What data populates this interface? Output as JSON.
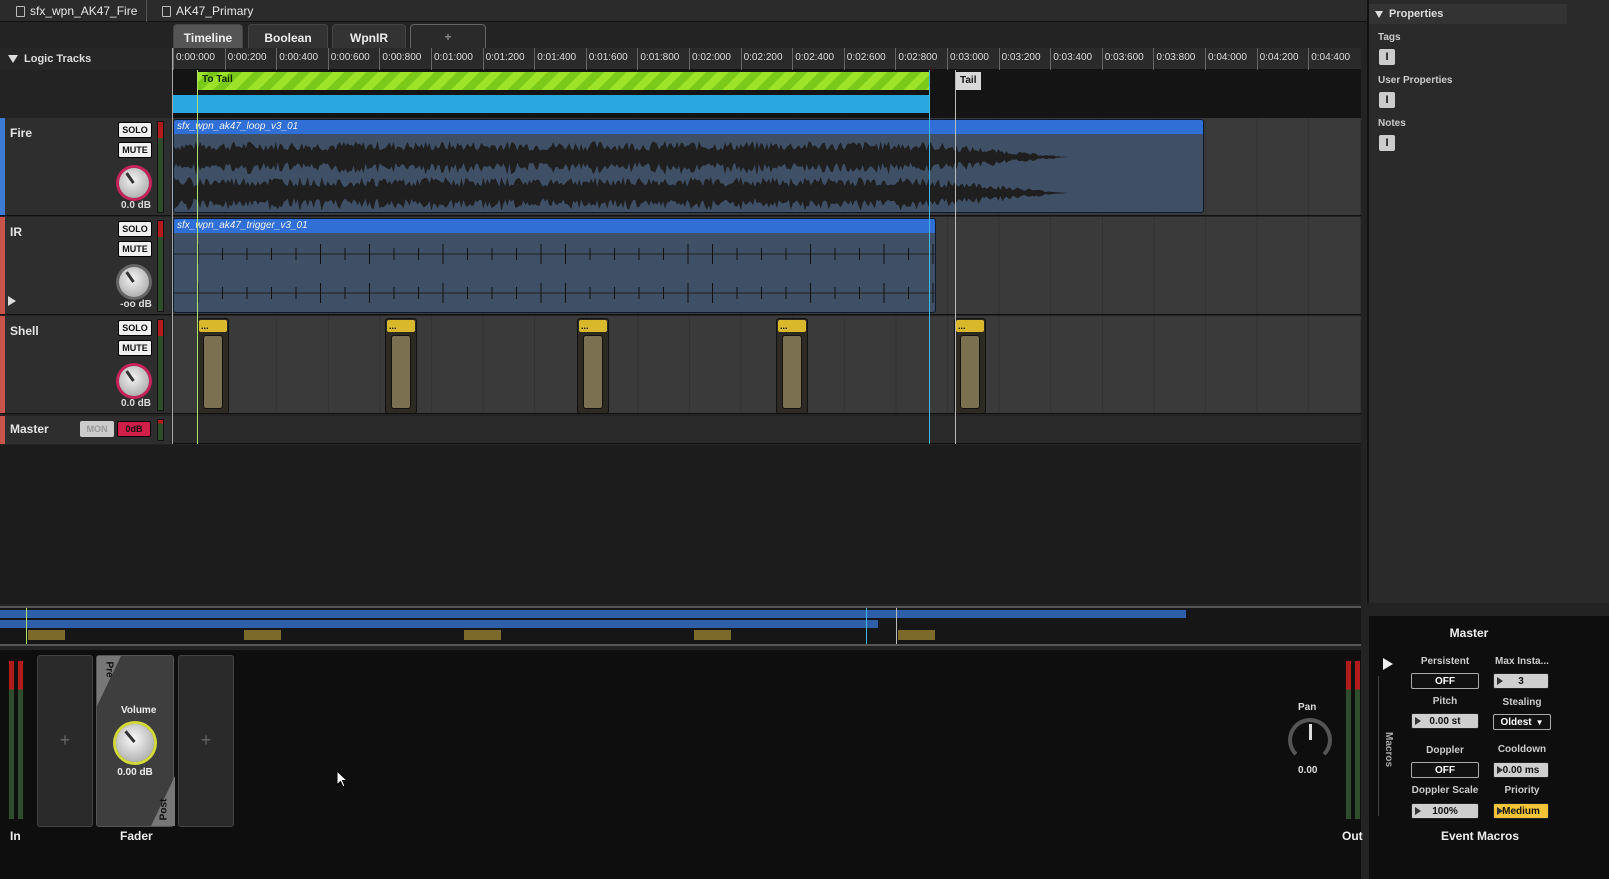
{
  "breadcrumb": [
    {
      "label": "sfx_wpn_AK47_Fire"
    },
    {
      "label": "AK47_Primary"
    }
  ],
  "tabs": [
    {
      "label": "Timeline",
      "active": true
    },
    {
      "label": "Boolean"
    },
    {
      "label": "WpnIR"
    },
    {
      "label": "+"
    }
  ],
  "logic_tracks_label": "Logic Tracks",
  "ruler": {
    "ticks": [
      "0:00:000",
      "0:00:200",
      "0:00:400",
      "0:00:600",
      "0:00:800",
      "0:01:000",
      "0:01:200",
      "0:01:400",
      "0:01:600",
      "0:01:800",
      "0:02:000",
      "0:02:200",
      "0:02:400",
      "0:02:600",
      "0:02:800",
      "0:03:000",
      "0:03:200",
      "0:03:400",
      "0:03:600",
      "0:03:800",
      "0:04:000",
      "0:04:200",
      "0:04:400"
    ]
  },
  "logic": {
    "loop_label": "To Tail",
    "marker_label": "Tail"
  },
  "tracks": [
    {
      "name": "Fire",
      "solo": "SOLO",
      "mute": "MUTE",
      "volume": "0.0 dB",
      "color": "#3b7bd1",
      "region": "sfx_wpn_ak47_loop_v3_01"
    },
    {
      "name": "IR",
      "solo": "SOLO",
      "mute": "MUTE",
      "volume": "-oo dB",
      "color": "#c9544c",
      "region": "sfx_wpn_ak47_trigger_v3_01"
    },
    {
      "name": "Shell",
      "solo": "SOLO",
      "mute": "MUTE",
      "volume": "0.0 dB",
      "color": "#c9544c",
      "instrument_tag": "..."
    }
  ],
  "master": {
    "name": "Master",
    "mon": "MON",
    "odb": "0dB"
  },
  "properties": {
    "title": "Properties",
    "tags": "Tags",
    "user_properties": "User Properties",
    "notes": "Notes",
    "button_glyph": "I"
  },
  "deck": {
    "in_label": "In",
    "fader_label": "Fader",
    "out_label": "Out",
    "pre": "Pre",
    "post": "Post",
    "volume_label": "Volume",
    "volume_value": "0.00 dB",
    "pan_label": "Pan",
    "pan_value": "0.00",
    "plus": "+"
  },
  "macros": {
    "title": "Master",
    "footer": "Event Macros",
    "side_label": "Macros",
    "persistent_label": "Persistent",
    "persistent_value": "OFF",
    "max_label": "Max Insta...",
    "max_value": "3",
    "pitch_label": "Pitch",
    "pitch_value": "0.00 st",
    "stealing_label": "Stealing",
    "stealing_value": "Oldest",
    "doppler_label": "Doppler",
    "doppler_value": "OFF",
    "cooldown_label": "Cooldown",
    "cooldown_value": "0.00 ms",
    "doppler_scale_label": "Doppler Scale",
    "doppler_scale_value": "100%",
    "priority_label": "Priority",
    "priority_value": "Medium"
  },
  "colors": {
    "loop": "#8fd622",
    "region": "#2f6fd6",
    "accent_red": "#d0204a",
    "priority": "#f3c436"
  }
}
